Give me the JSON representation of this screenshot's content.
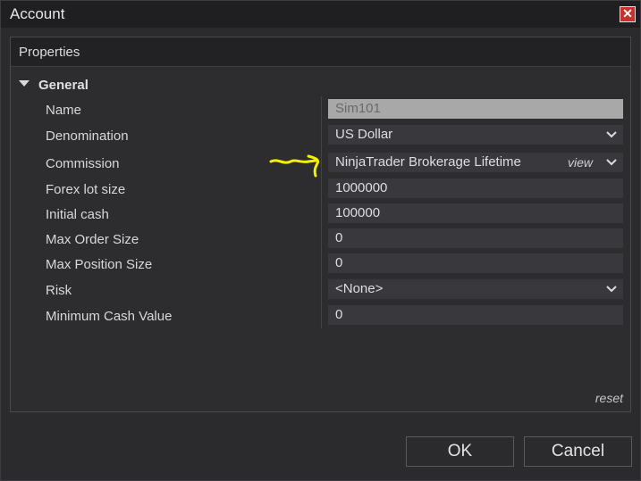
{
  "window": {
    "title": "Account",
    "close_glyph": "✕"
  },
  "panel": {
    "header": "Properties"
  },
  "group": {
    "label": "General",
    "toggle_icon": "triangle-down-icon"
  },
  "properties": [
    {
      "label": "Name",
      "value": "Sim101",
      "type": "text-disabled"
    },
    {
      "label": "Denomination",
      "value": "US Dollar",
      "type": "dropdown"
    },
    {
      "label": "Commission",
      "value": "NinjaTrader Brokerage Lifetime",
      "type": "dropdown",
      "link": "view"
    },
    {
      "label": "Forex lot size",
      "value": "1000000",
      "type": "text"
    },
    {
      "label": "Initial cash",
      "value": "100000",
      "type": "text"
    },
    {
      "label": "Max Order Size",
      "value": "0",
      "type": "text"
    },
    {
      "label": "Max Position Size",
      "value": "0",
      "type": "text"
    },
    {
      "label": "Risk",
      "value": "<None>",
      "type": "dropdown"
    },
    {
      "label": "Minimum Cash Value",
      "value": "0",
      "type": "text"
    }
  ],
  "reset_label": "reset",
  "buttons": {
    "ok": "OK",
    "cancel": "Cancel"
  },
  "colors": {
    "close_button": "#c8302c",
    "annotation": "#f2f200",
    "field_bg": "#39393d"
  }
}
